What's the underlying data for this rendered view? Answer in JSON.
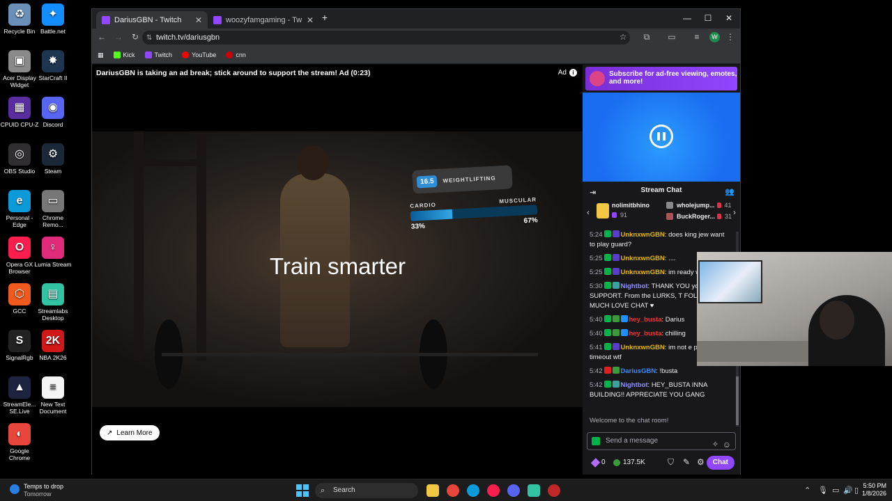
{
  "desktop": {
    "icons": [
      {
        "label": "Recycle Bin",
        "color": "#6a8fb8",
        "glyph": "♻"
      },
      {
        "label": "Battle.net",
        "color": "#148eff",
        "glyph": "✦"
      },
      {
        "label": "Acer Display Widget",
        "color": "#8a8a8a",
        "glyph": "▣"
      },
      {
        "label": "StarCraft II",
        "color": "#1e3550",
        "glyph": "✸"
      },
      {
        "label": "CPUID CPU-Z",
        "color": "#5a2ea0",
        "glyph": "▦"
      },
      {
        "label": "Discord",
        "color": "#5865f2",
        "glyph": "◉"
      },
      {
        "label": "OBS Studio",
        "color": "#302e31",
        "glyph": "◎"
      },
      {
        "label": "Steam",
        "color": "#1b2838",
        "glyph": "⚙"
      },
      {
        "label": "Personal - Edge",
        "color": "#0c9bd8",
        "glyph": "e"
      },
      {
        "label": "Chrome Remo...",
        "color": "#777777",
        "glyph": "▭"
      },
      {
        "label": "Opera GX Browser",
        "color": "#fa1e4e",
        "glyph": "O"
      },
      {
        "label": "Lumia Stream",
        "color": "#e02a7a",
        "glyph": "♀"
      },
      {
        "label": "GCC",
        "color": "#f05a1e",
        "glyph": "⬡"
      },
      {
        "label": "Streamlabs Desktop",
        "color": "#31c3a2",
        "glyph": "▤"
      },
      {
        "label": "SignalRgb",
        "color": "#222222",
        "glyph": "S"
      },
      {
        "label": "NBA 2K26",
        "color": "#d01818",
        "glyph": "2K"
      },
      {
        "label": "StreamEle... SE.Live",
        "color": "#1e2340",
        "glyph": "▲"
      },
      {
        "label": "New Text Document",
        "color": "#f4f4f4",
        "glyph": "≡"
      },
      {
        "label": "Google Chrome",
        "color": "#e8453c",
        "glyph": "◐"
      }
    ]
  },
  "browser": {
    "tabs": [
      {
        "title": "DariusGBN - Twitch",
        "active": true
      },
      {
        "title": "woozyfamgaming - Twitch",
        "active": false
      }
    ],
    "new_tab": "+",
    "window": {
      "minimize": "—",
      "maximize": "☐",
      "close": "✕"
    },
    "nav": {
      "back": "←",
      "forward": "→",
      "reload": "↻"
    },
    "url": "twitch.tv/dariusgbn",
    "site_info_icon": "⇅",
    "star_icon": "☆",
    "extensions_icon": "⧉",
    "avatar_letter": "W",
    "menu_icon": "⋮",
    "apps_icon": "▦",
    "bookmarks": [
      {
        "label": "Kick",
        "color": "#53fc18"
      },
      {
        "label": "Twitch",
        "color": "#9146ff"
      },
      {
        "label": "YouTube",
        "color": "#ff0000"
      },
      {
        "label": "cnn",
        "color": "#cc0000"
      }
    ]
  },
  "player": {
    "ad_banner": "DariusGBN is taking an ad break; stick around to support the stream! Ad (0:23)",
    "ad_label": "Ad",
    "ad_info": "i",
    "overlay_text": "Train smarter",
    "weightlifting_value": "16.5",
    "weightlifting_label": "WEIGHTLIFTING",
    "cardio_label": "CARDIO",
    "muscular_label": "MUSCULAR",
    "cardio_pct": "33%",
    "muscular_pct": "67%",
    "cardio_fraction": 0.33,
    "learn_more": "Learn More",
    "learn_more_icon": "↗"
  },
  "sidebar": {
    "sub_banner": "Subscribe for ad-free viewing, emotes, and more!",
    "chat_title": "Stream Chat",
    "collapse_icon": "⇥",
    "users_icon": "👥",
    "leaderboard": [
      {
        "name": "nolimitbhino",
        "count": "91"
      },
      {
        "name": "wholejump...",
        "count": "41"
      },
      {
        "name": "BuckRoger...",
        "count": "31"
      }
    ],
    "prev_arrow": "‹",
    "next_arrow": "›",
    "messages": [
      {
        "time": "5:24",
        "user": "UnknxwnGBN",
        "color": "#e6b800",
        "text": ": does king jew want to play guard?",
        "badges": [
          "#00b44b",
          "#5a3ec8"
        ]
      },
      {
        "time": "5:25",
        "user": "UnknxwnGBN",
        "color": "#e6b800",
        "text": ": ....",
        "badges": [
          "#00b44b",
          "#5a3ec8"
        ]
      },
      {
        "time": "5:25",
        "user": "UnknxwnGBN",
        "color": "#e6b800",
        "text": ": im ready whenever",
        "badges": [
          "#00b44b",
          "#5a3ec8"
        ]
      },
      {
        "time": "5:30",
        "user": "Nightbot",
        "color": "#8f90ff",
        "text": ": THANK YOU your SUPPORT. From the LURKS, T FOLLOWS! MUCH LOVE CHAT ♥",
        "badges": [
          "#00b44b",
          "#3aa0a0"
        ]
      },
      {
        "time": "5:40",
        "user": "hey_busta",
        "color": "#ff3030",
        "text": ": Darius",
        "badges": [
          "#00b44b",
          "#3b9b3b",
          "#1e90ff"
        ]
      },
      {
        "time": "5:40",
        "user": "hey_busta",
        "color": "#ff3030",
        "text": ": chilling",
        "badges": [
          "#00b44b",
          "#3b9b3b",
          "#1e90ff"
        ]
      },
      {
        "time": "5:41",
        "user": "UnknxwnGBN",
        "color": "#e6b800",
        "text": ": im not e pressing timeout wtf",
        "badges": [
          "#00b44b",
          "#5a3ec8"
        ]
      },
      {
        "time": "5:42",
        "user": "DariusGBN",
        "color": "#3b8bff",
        "text": ": !busta",
        "badges": [
          "#e02020",
          "#3b9b3b"
        ]
      },
      {
        "time": "5:42",
        "user": "Nightbot",
        "color": "#8f90ff",
        "text": ": HEY_BUSTA INNA BUILDING!! APPRECIATE YOU GANG",
        "badges": [
          "#00b44b",
          "#3aa0a0"
        ]
      }
    ],
    "welcome": "Welcome to the chat room!",
    "input_placeholder": "Send a message",
    "emote_icon": "☺",
    "spark_icon": "✧",
    "bits": "0",
    "points": "137.5K",
    "shield_icon": "⛉",
    "pen_icon": "✎",
    "settings_icon": "⚙",
    "chat_button": "Chat"
  },
  "taskbar": {
    "weather_title": "Temps to drop",
    "weather_sub": "Tomorrow",
    "search_label": "Search",
    "search_icon": "⌕",
    "apps": [
      {
        "name": "file-explorer",
        "color": "#f2c744"
      },
      {
        "name": "chrome",
        "color": "#e8453c"
      },
      {
        "name": "edge",
        "color": "#0c9bd8"
      },
      {
        "name": "opera-gx",
        "color": "#fa1e4e"
      },
      {
        "name": "discord",
        "color": "#5865f2"
      },
      {
        "name": "streamlabs",
        "color": "#31c3a2"
      },
      {
        "name": "app-red",
        "color": "#c02828"
      }
    ],
    "time": "5:50 PM",
    "date": "1/8/2026",
    "tray_up": "⌃",
    "mic_icon": "🎙",
    "network_icon": "▭",
    "volume_icon": "🔊",
    "battery_icon": "▯"
  }
}
